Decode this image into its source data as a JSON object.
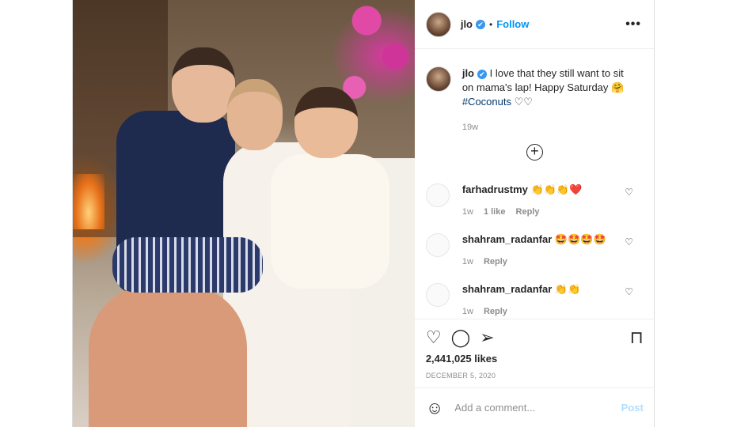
{
  "header": {
    "username": "jlo",
    "verified_mark": "✔",
    "separator": "•",
    "follow_label": "Follow",
    "more_label": "•••"
  },
  "caption": {
    "username": "jlo",
    "text": "I love that they still want to sit on mama's lap! Happy Saturday 🤗",
    "hashtag": "#Coconuts",
    "hearts": "♡♡",
    "time": "19w"
  },
  "load_more_label": "+",
  "comments": [
    {
      "username": "farhadrustmy",
      "text": "👏👏👏❤️",
      "time": "1w",
      "likes": "1 like",
      "reply": "Reply",
      "heart": "♡"
    },
    {
      "username": "shahram_radanfar",
      "text": "🤩🤩🤩🤩",
      "time": "1w",
      "likes": "",
      "reply": "Reply",
      "heart": "♡"
    },
    {
      "username": "shahram_radanfar",
      "text": "👏👏",
      "time": "1w",
      "likes": "",
      "reply": "Reply",
      "heart": "♡"
    }
  ],
  "actions": {
    "like_icon": "♡",
    "comment_icon": "◯",
    "share_icon": "➢",
    "save_icon": "⊓"
  },
  "likes": "2,441,025 likes",
  "date": "DECEMBER 5, 2020",
  "add_comment": {
    "emoji_icon": "☺",
    "placeholder": "Add a comment...",
    "post_label": "Post"
  }
}
